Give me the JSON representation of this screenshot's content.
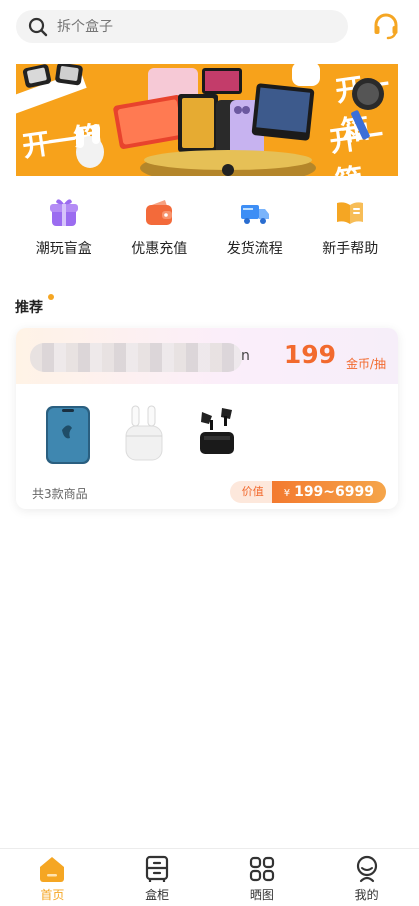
{
  "search": {
    "placeholder": "拆个盒子",
    "icon": "search-icon"
  },
  "header": {
    "support_icon": "headset-icon"
  },
  "banner": {
    "slogan": "开一箱"
  },
  "quick_nav": [
    {
      "label": "潮玩盲盒",
      "icon": "gift-box-icon",
      "color": "#9b6cf0"
    },
    {
      "label": "优惠充值",
      "icon": "wallet-icon",
      "color": "#f36a3a"
    },
    {
      "label": "发货流程",
      "icon": "truck-icon",
      "color": "#3d8ef5"
    },
    {
      "label": "新手帮助",
      "icon": "book-icon",
      "color": "#f5a623"
    }
  ],
  "section": {
    "title": "推荐"
  },
  "card": {
    "name_tail": "n",
    "price": "199",
    "price_unit": "金币/抽",
    "count_text": "共3款商品",
    "value_label": "价值",
    "value_currency": "¥",
    "value_range": "199~6999",
    "products": [
      "iphone-image",
      "airpods-image",
      "earbuds-image"
    ]
  },
  "tab_bar": [
    {
      "label": "首页",
      "icon": "home-icon",
      "active": true
    },
    {
      "label": "盒柜",
      "icon": "cabinet-icon",
      "active": false
    },
    {
      "label": "晒图",
      "icon": "grid-icon",
      "active": false
    },
    {
      "label": "我的",
      "icon": "profile-icon",
      "active": false
    }
  ],
  "colors": {
    "accent": "#f5a623",
    "price": "#f26a2e"
  }
}
